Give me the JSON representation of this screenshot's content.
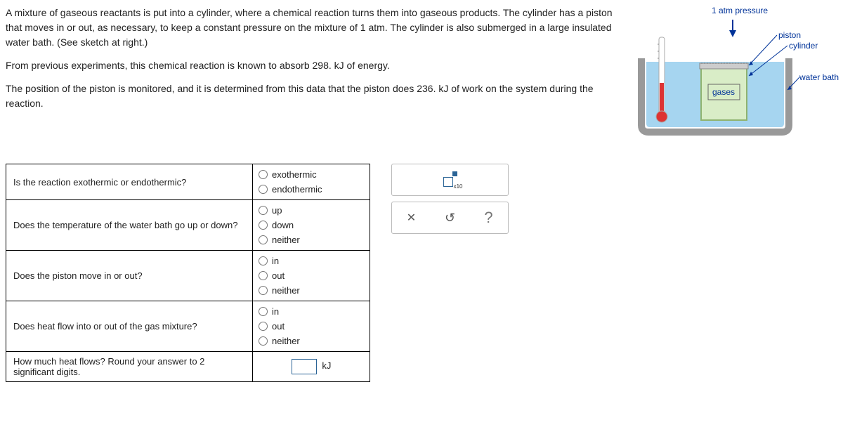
{
  "problem": {
    "p1": "A mixture of gaseous reactants is put into a cylinder, where a chemical reaction turns them into gaseous products. The cylinder has a piston that moves in or out, as necessary, to keep a constant pressure on the mixture of 1 atm. The cylinder is also submerged in a large insulated water bath. (See sketch at right.)",
    "p2": "From previous experiments, this chemical reaction is known to absorb 298. kJ of energy.",
    "p3": "The position of the piston is monitored, and it is determined from this data that the piston does 236. kJ of work on the system during the reaction."
  },
  "diagram": {
    "pressure": "1 atm pressure",
    "piston": "piston",
    "cylinder": "cylinder",
    "water_bath": "water bath",
    "gases": "gases"
  },
  "questions": {
    "q1": {
      "text": "Is the reaction exothermic or endothermic?",
      "opts": [
        "exothermic",
        "endothermic"
      ]
    },
    "q2": {
      "text": "Does the temperature of the water bath go up or down?",
      "opts": [
        "up",
        "down",
        "neither"
      ]
    },
    "q3": {
      "text": "Does the piston move in or out?",
      "opts": [
        "in",
        "out",
        "neither"
      ]
    },
    "q4": {
      "text": "Does heat flow into or out of the gas mixture?",
      "opts": [
        "in",
        "out",
        "neither"
      ]
    },
    "q5": {
      "text": "How much heat flows? Round your answer to 2 significant digits.",
      "unit": "kJ"
    }
  },
  "palette": {
    "x10": "x10",
    "clear": "✕",
    "reset": "↺",
    "help": "?"
  }
}
